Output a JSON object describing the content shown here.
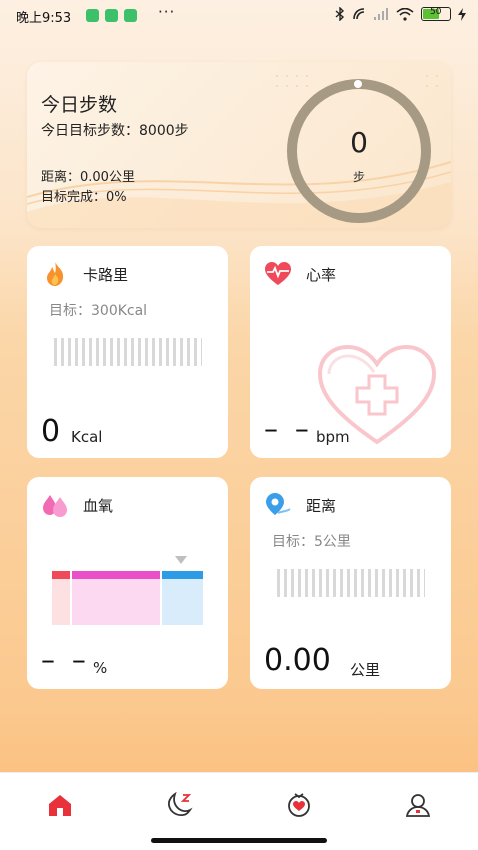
{
  "status_bar": {
    "time": "晚上9:53",
    "more": "···",
    "battery": "50"
  },
  "summary": {
    "title": "今日步数",
    "goal": "今日目标步数：8000步",
    "distance": "距离：0.00公里",
    "completion": "目标完成：0%",
    "steps_value": "0",
    "steps_unit": "步",
    "steps_progress": 0
  },
  "calories": {
    "title": "卡路里",
    "goal": "目标：300Kcal",
    "value": "0",
    "unit": "Kcal"
  },
  "heart_rate": {
    "title": "心率",
    "value": "– –",
    "unit": "bpm"
  },
  "spo2": {
    "title": "血氧",
    "value": "– –",
    "unit": "%"
  },
  "distance": {
    "title": "距离",
    "goal": "目标：5公里",
    "value": "0.00",
    "unit": "公里"
  },
  "nav": {
    "items": [
      "home-icon",
      "sleep-icon",
      "health-icon",
      "profile-icon"
    ],
    "active": 0
  },
  "colors": {
    "accent": "#e8313a",
    "ring": "#a69a85"
  }
}
